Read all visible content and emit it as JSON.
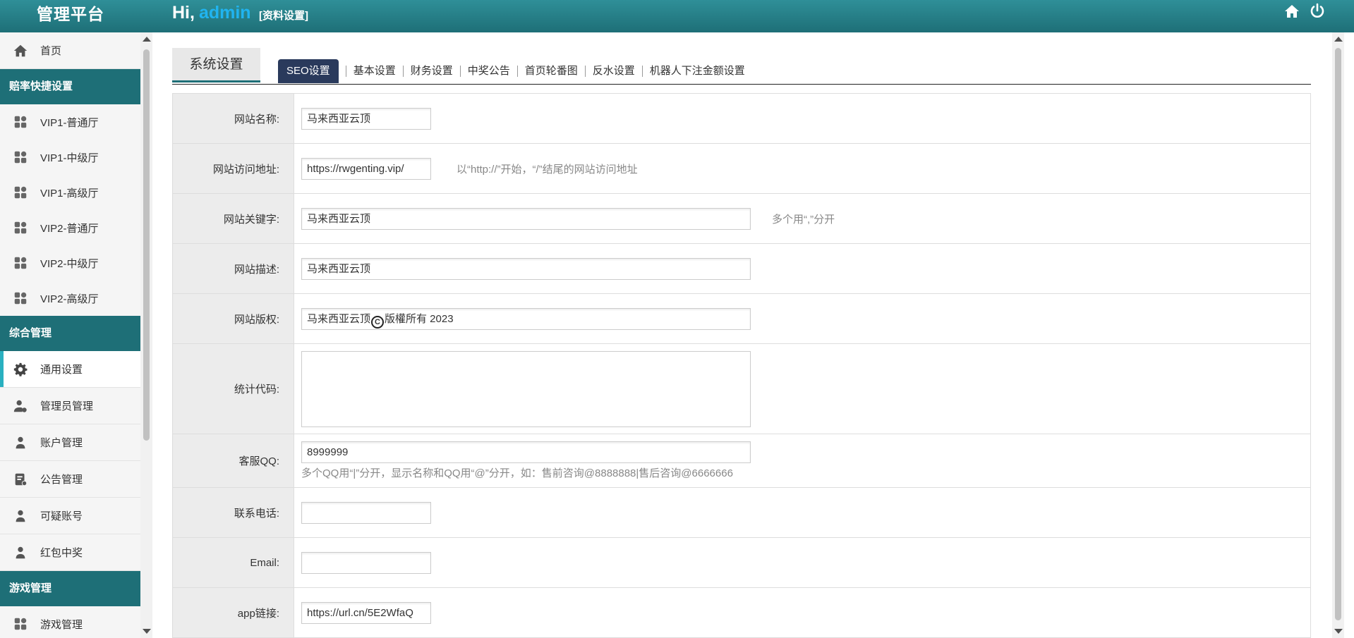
{
  "header": {
    "logo": "管理平台",
    "greeting": "Hi,",
    "username": "admin",
    "profile_link": "[资料设置]",
    "icons": [
      "home-icon",
      "power-icon"
    ]
  },
  "sidebar": {
    "home": "首页",
    "groups": [
      {
        "title": "赔率快捷设置",
        "items": [
          "VIP1-普通厅",
          "VIP1-中级厅",
          "VIP1-高级厅",
          "VIP2-普通厅",
          "VIP2-中级厅",
          "VIP2-高级厅"
        ]
      },
      {
        "title": "综合管理",
        "items": [
          "通用设置",
          "管理员管理",
          "账户管理",
          "公告管理",
          "可疑账号",
          "红包中奖"
        ]
      },
      {
        "title": "游戏管理",
        "items": [
          "游戏管理"
        ]
      }
    ]
  },
  "main": {
    "section_title": "系统设置",
    "tabs": [
      "SEO设置",
      "基本设置",
      "财务设置",
      "中奖公告",
      "首页轮番图",
      "反水设置",
      "机器人下注金额设置"
    ],
    "active_tab": "SEO设置",
    "form": {
      "site_name": {
        "label": "网站名称:",
        "value": "马来西亚云顶"
      },
      "site_url": {
        "label": "网站访问地址:",
        "value": "https://rwgenting.vip/",
        "hint": "以“http://”开始，“/”结尾的网站访问地址"
      },
      "keywords": {
        "label": "网站关键字:",
        "value": "马来西亚云顶",
        "hint": "多个用“,”分开"
      },
      "description": {
        "label": "网站描述:",
        "value": "马来西亚云顶"
      },
      "copyright": {
        "label": "网站版权:",
        "value_prefix": "马来西亚云顶",
        "copyright_symbol": "C",
        "value_suffix": "版權所有 2023"
      },
      "stat_code": {
        "label": "统计代码:",
        "value": ""
      },
      "qq": {
        "label": "客服QQ:",
        "value": "8999999",
        "hint": "多个QQ用“|”分开，显示名称和QQ用“@”分开，如：售前咨询@8888888|售后咨询@6666666"
      },
      "phone": {
        "label": "联系电话:",
        "value": ""
      },
      "email": {
        "label": "Email:",
        "value": ""
      },
      "app_link": {
        "label": "app链接:",
        "value": "https://url.cn/5E2WfaQ"
      }
    }
  },
  "colors": {
    "header": "#1e6f77",
    "group_bg": "#1e6f77",
    "active_tab": "#2a3a5c",
    "username": "#20b4f0",
    "active_marker": "#2ab0c0"
  }
}
